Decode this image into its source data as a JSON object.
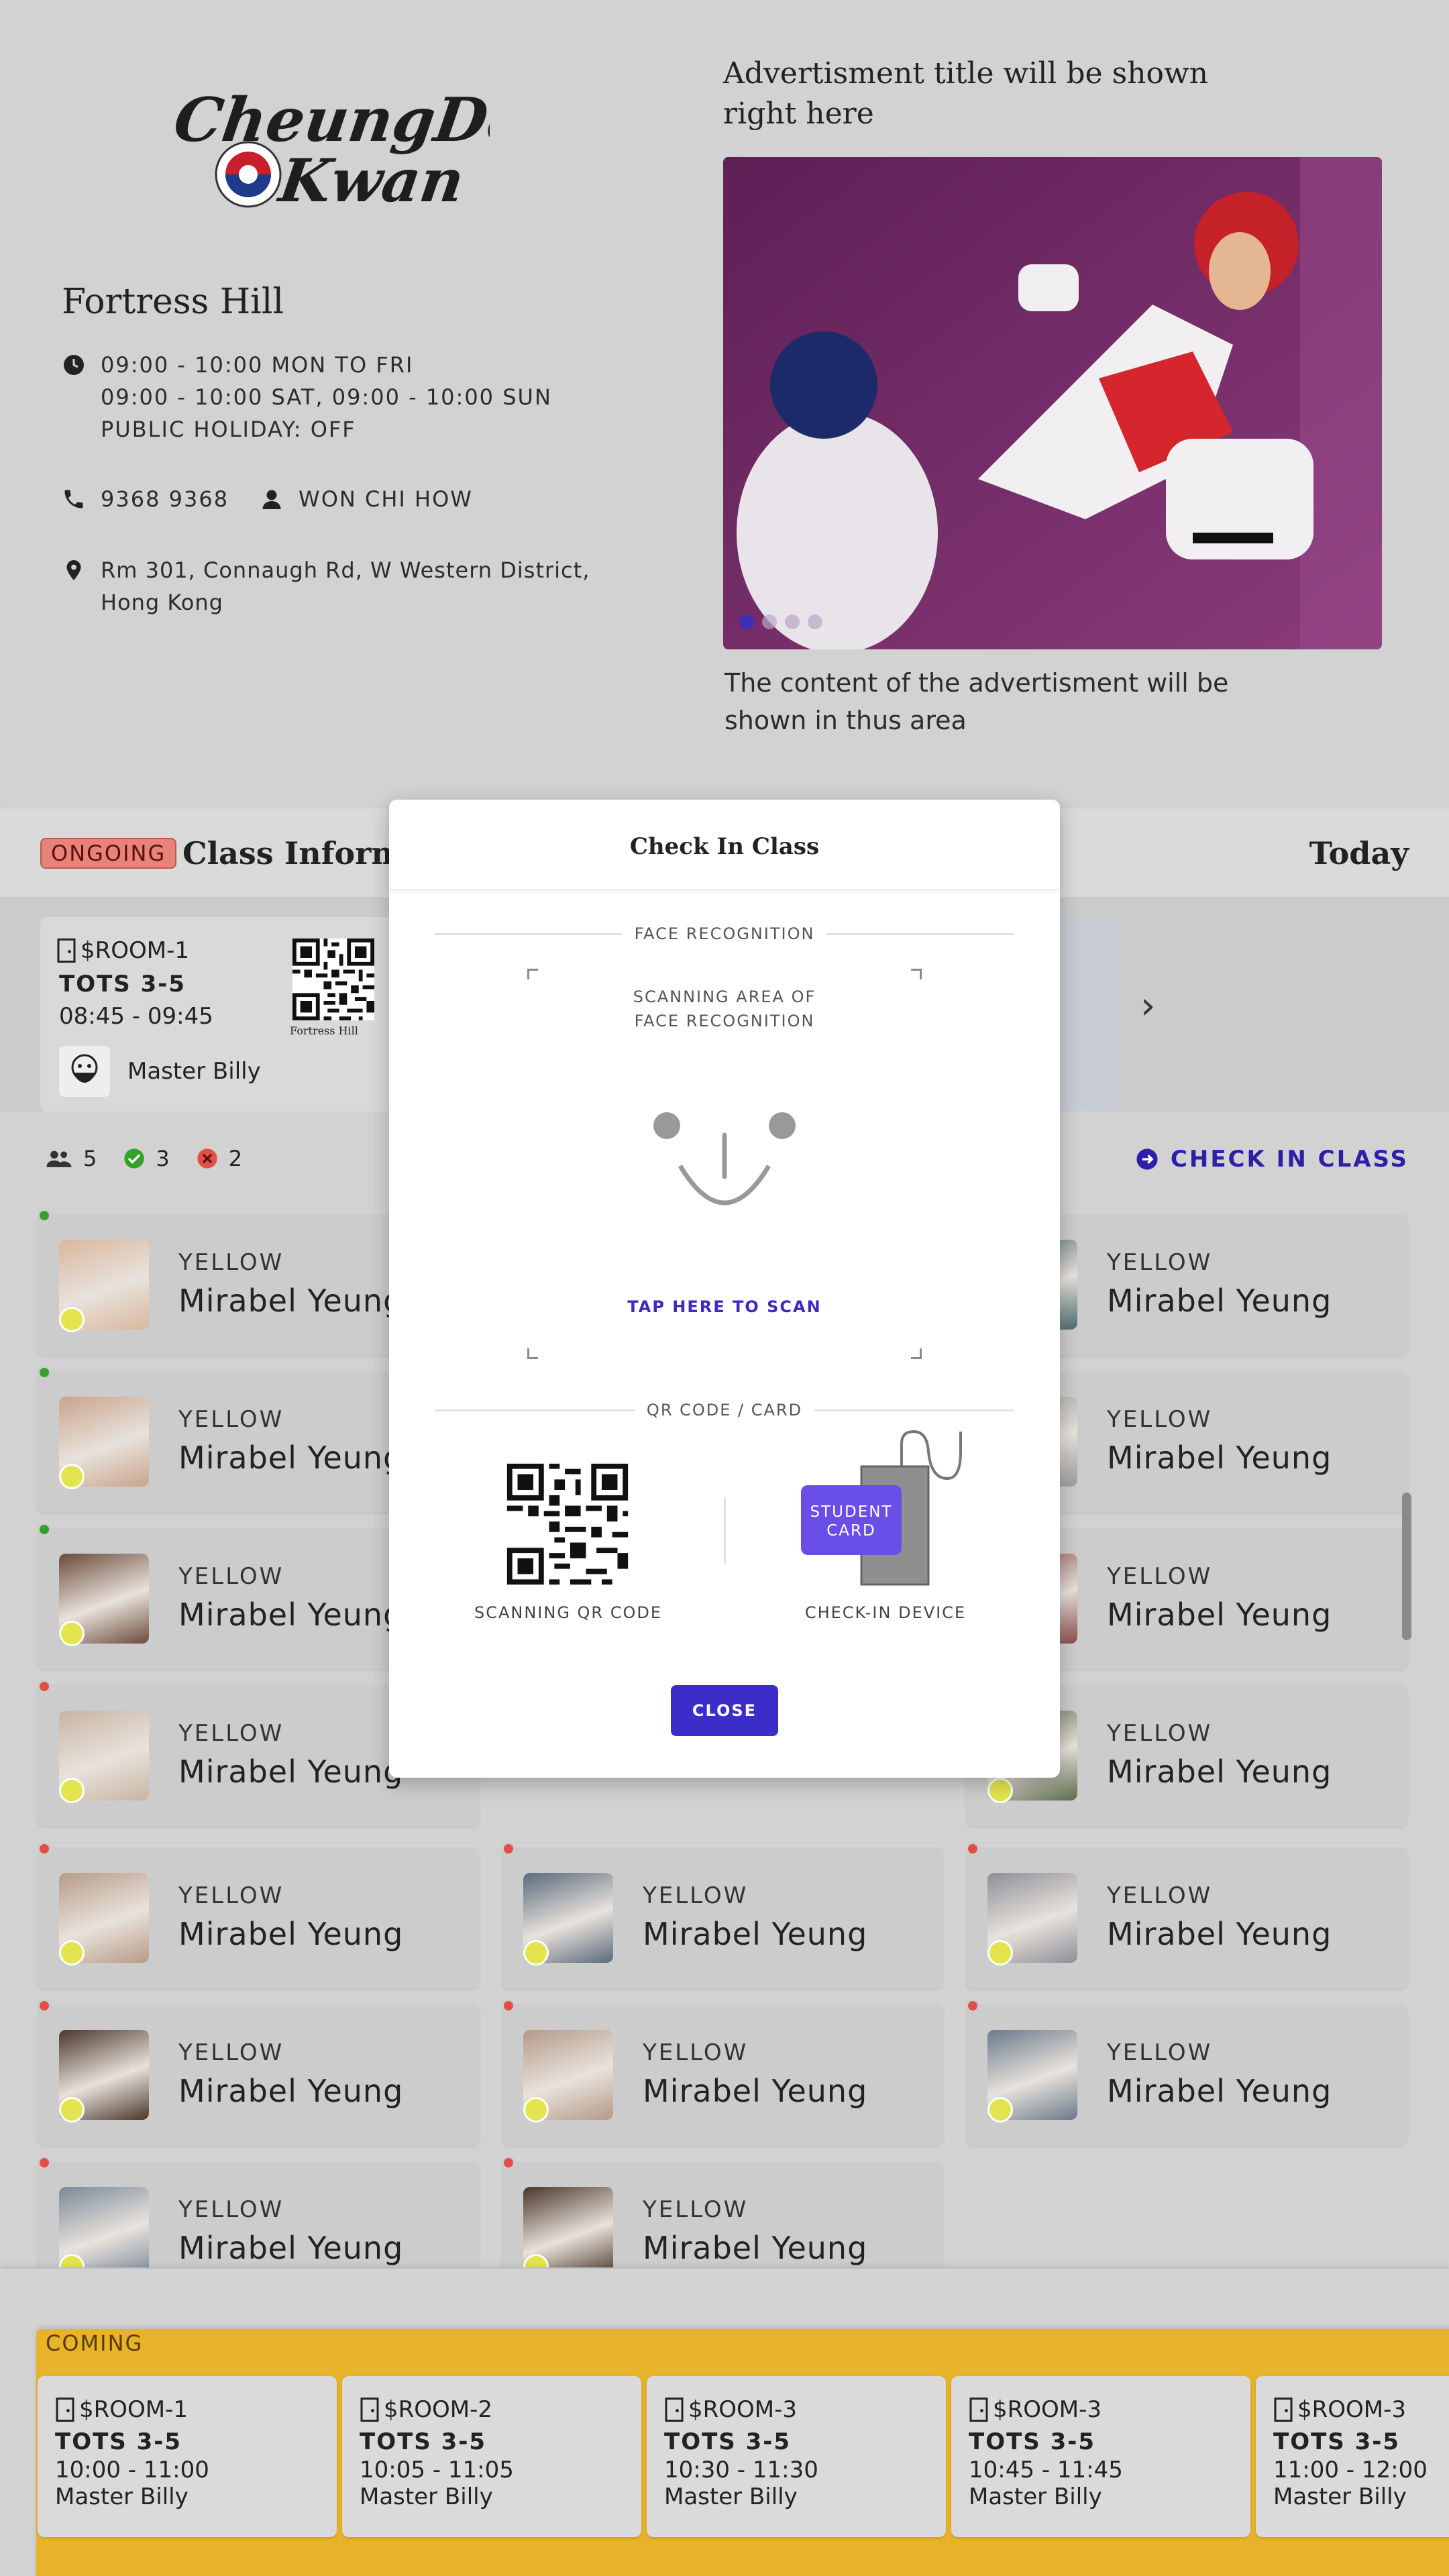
{
  "brand": {
    "line1": "CheungDo",
    "line2": "Kwan"
  },
  "branch": {
    "name": "Fortress Hill",
    "hours": [
      "09:00 - 10:00 MON TO FRI",
      "09:00 - 10:00 SAT, 09:00 - 10:00 SUN",
      "PUBLIC HOLIDAY: OFF"
    ],
    "phone": "9368 9368",
    "contact": "WON CHI HOW",
    "address_line1": "Rm 301, Connaugh Rd, W Western District,",
    "address_line2": "Hong Kong"
  },
  "advert": {
    "title_line1": "Advertisment title will be shown",
    "title_line2": "right here",
    "content_line1": "The content of the advertisment will be",
    "content_line2": "shown in thus area"
  },
  "class_bar": {
    "ongoing_tag": "ONGOING",
    "title": "Class Informat",
    "today": "Today"
  },
  "current_class": {
    "room": "$ROOM-1",
    "name": "TOTS 3-5",
    "time": "08:45 - 09:45",
    "master": "Master Billy",
    "qr_label": "Fortress Hill"
  },
  "stats": {
    "total": "5",
    "present": "3",
    "absent": "2",
    "checkin_label": "CHECK IN CLASS"
  },
  "students": [
    {
      "belt": "YELLOW",
      "name": "Mirabel Yeung",
      "status": "present",
      "col": 0,
      "row": 0,
      "tone": "#d9b79c"
    },
    {
      "belt": "YELLOW",
      "name": "Mirabel Yeung",
      "status": "present",
      "col": 2,
      "row": 0,
      "tone": "#4b6a6e"
    },
    {
      "belt": "YELLOW",
      "name": "Mirabel Yeung",
      "status": "present",
      "col": 0,
      "row": 1,
      "tone": "#c9a48c"
    },
    {
      "belt": "YELLOW",
      "name": "Mirabel Yeung",
      "status": "present",
      "col": 2,
      "row": 1,
      "tone": "#9b9b9b"
    },
    {
      "belt": "YELLOW",
      "name": "Mirabel Yeung",
      "status": "present",
      "col": 0,
      "row": 2,
      "tone": "#6b4a3a"
    },
    {
      "belt": "YELLOW",
      "name": "Mirabel Yeung",
      "status": "present",
      "col": 2,
      "row": 2,
      "tone": "#8a4a48"
    },
    {
      "belt": "YELLOW",
      "name": "Mirabel Yeung",
      "status": "absent",
      "col": 0,
      "row": 3,
      "tone": "#c8b4a3"
    },
    {
      "belt": "YELLOW",
      "name": "Mirabel Yeung",
      "status": "absent",
      "col": 2,
      "row": 3,
      "tone": "#5a6a4a"
    },
    {
      "belt": "YELLOW",
      "name": "Mirabel Yeung",
      "status": "absent",
      "col": 0,
      "row": 4,
      "tone": "#b89b88"
    },
    {
      "belt": "YELLOW",
      "name": "Mirabel Yeung",
      "status": "absent",
      "col": 1,
      "row": 4,
      "tone": "#5a6a7a"
    },
    {
      "belt": "YELLOW",
      "name": "Mirabel Yeung",
      "status": "absent",
      "col": 2,
      "row": 4,
      "tone": "#8e8f98"
    },
    {
      "belt": "YELLOW",
      "name": "Mirabel Yeung",
      "status": "absent",
      "col": 0,
      "row": 5,
      "tone": "#4a362a"
    },
    {
      "belt": "YELLOW",
      "name": "Mirabel Yeung",
      "status": "absent",
      "col": 1,
      "row": 5,
      "tone": "#b49a88"
    },
    {
      "belt": "YELLOW",
      "name": "Mirabel Yeung",
      "status": "absent",
      "col": 2,
      "row": 5,
      "tone": "#6a7a8a"
    },
    {
      "belt": "YELLOW",
      "name": "Mirabel Yeung",
      "status": "absent",
      "col": 0,
      "row": 6,
      "tone": "#7a8a98"
    },
    {
      "belt": "YELLOW",
      "name": "Mirabel Yeung",
      "status": "absent",
      "col": 1,
      "row": 6,
      "tone": "#4a362a"
    }
  ],
  "coming": {
    "tag": "COMING",
    "classes": [
      {
        "room": "$ROOM-1",
        "name": "TOTS 3-5",
        "time": "10:00 - 11:00",
        "master": "Master Billy"
      },
      {
        "room": "$ROOM-2",
        "name": "TOTS 3-5",
        "time": "10:05 - 11:05",
        "master": "Master Billy"
      },
      {
        "room": "$ROOM-3",
        "name": "TOTS 3-5",
        "time": "10:30 - 11:30",
        "master": "Master Billy"
      },
      {
        "room": "$ROOM-3",
        "name": "TOTS 3-5",
        "time": "10:45 - 11:45",
        "master": "Master Billy"
      },
      {
        "room": "$ROOM-3",
        "name": "TOTS 3-5",
        "time": "11:00 - 12:00",
        "master": "Master Billy"
      }
    ]
  },
  "modal": {
    "title": "Check In Class",
    "face_section": "FACE RECOGNITION",
    "scan_area_line1": "SCANNING AREA OF",
    "scan_area_line2": "FACE RECOGNITION",
    "tap_to_scan": "TAP HERE TO SCAN",
    "qr_section": "QR CODE / CARD",
    "qr_caption": "SCANNING QR CODE",
    "card_label_line1": "STUDENT",
    "card_label_line2": "CARD",
    "device_caption": "CHECK-IN DEVICE",
    "close_label": "CLOSE"
  },
  "colors": {
    "accent": "#3d2dc8",
    "present": "#36a02c",
    "absent": "#e05047",
    "ongoing": "#e8837a",
    "coming": "#e6b32a"
  }
}
